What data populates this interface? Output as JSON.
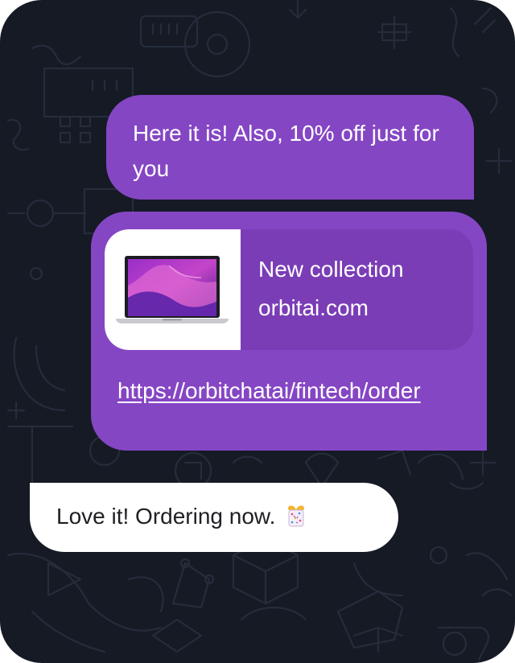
{
  "messages": {
    "outgoing_text": "Here it is! Also, 10% off just for you",
    "link_preview": {
      "title": "New collection",
      "domain": "orbitai.com",
      "thumbnail": "laptop-image",
      "url": "https://orbitchatai/fintech/order"
    },
    "incoming_text": "Love it! Ordering now.",
    "incoming_emoji": "gift-confetti-icon"
  },
  "colors": {
    "background": "#151a25",
    "outgoing_bubble": "#8546c4",
    "preview_panel": "#7a3db6",
    "incoming_bubble": "#ffffff",
    "incoming_text": "#1f1f24"
  }
}
